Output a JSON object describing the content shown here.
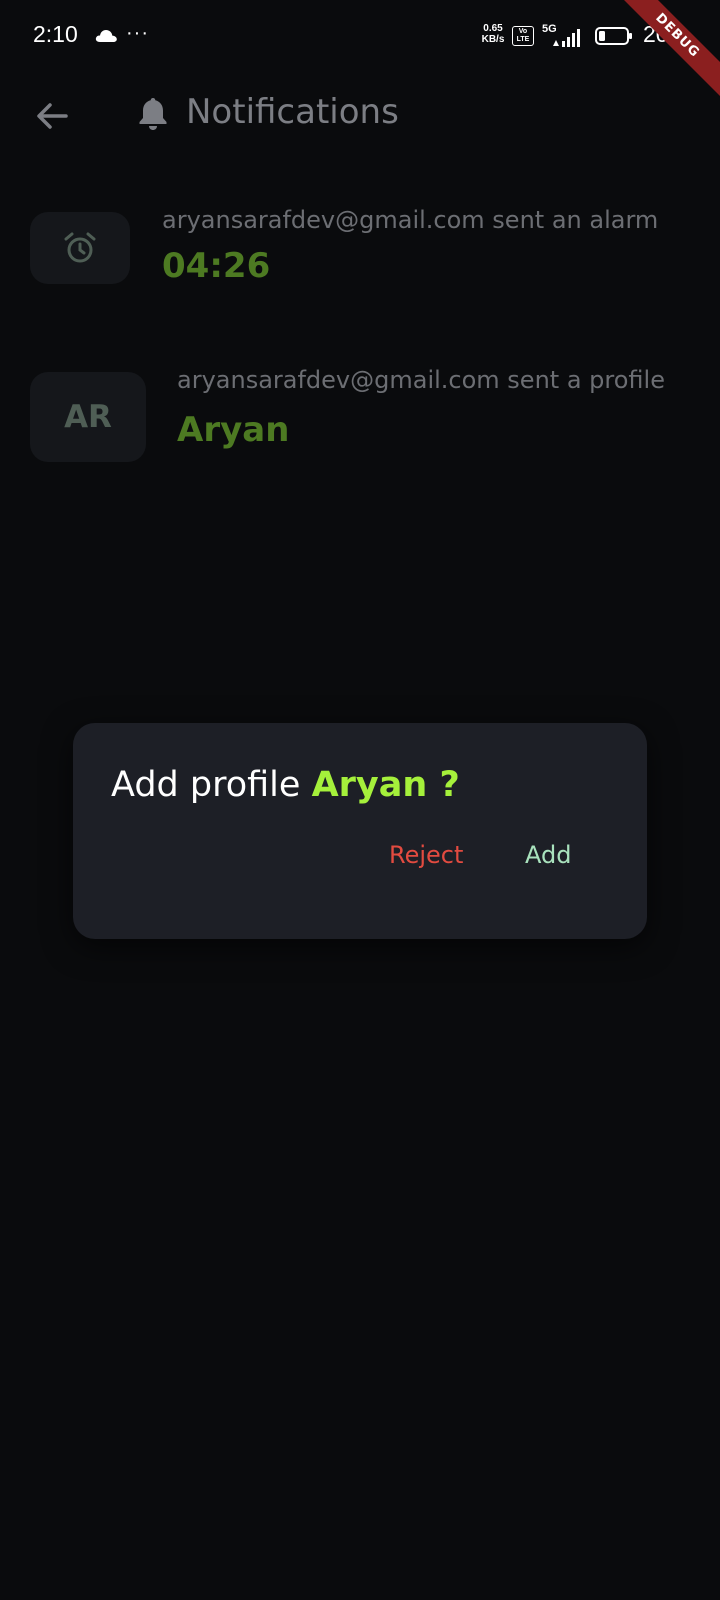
{
  "status_bar": {
    "time": "2:10",
    "more": "···",
    "net_speed_value": "0.65",
    "net_speed_unit": "KB/s",
    "volte_top": "Vo",
    "volte_bottom": "LTE",
    "network_type": "5G",
    "battery": "20",
    "icons": [
      "cloud-icon",
      "signal-icon",
      "battery-icon"
    ]
  },
  "debug_banner": "DEBUG",
  "app_bar": {
    "title": "Notifications",
    "icons": [
      "back-arrow-icon",
      "bell-icon"
    ]
  },
  "notifications": [
    {
      "icon": "alarm-clock-icon",
      "message": "aryansarafdev@gmail.com sent an alarm",
      "value": "04:26"
    },
    {
      "initials": "AR",
      "message": "aryansarafdev@gmail.com sent a profile",
      "value": "Aryan"
    }
  ],
  "dialog": {
    "prefix": "Add profile ",
    "name": "Aryan",
    "suffix": " ?",
    "reject_label": "Reject",
    "add_label": "Add"
  },
  "colors": {
    "background": "#0a0b0d",
    "accent_green": "#a5f03b",
    "dim_green": "#4d7a22",
    "reject_red": "#e34b40",
    "add_mint": "#a9e2bd",
    "dialog_bg": "#1d1f26",
    "debug_red": "#8b1f1f"
  }
}
